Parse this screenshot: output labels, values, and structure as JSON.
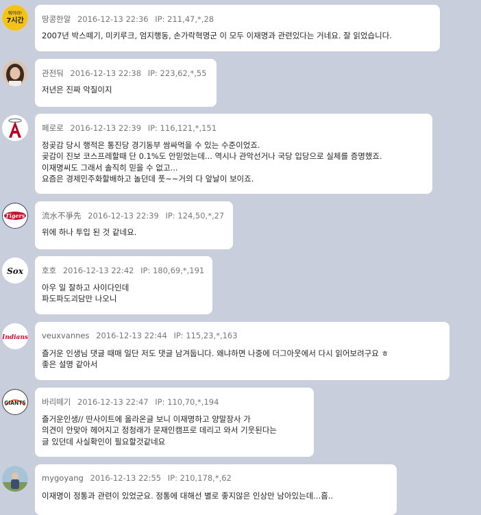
{
  "comments": [
    {
      "id": "c1",
      "nick": "땅콩한알",
      "datetime": "2016-12-13 22:36",
      "ip": "IP: 211,47,*,28",
      "lines": [
        "2007년 박스떼기, 미키루크, 엄지행동, 손가락혁명군 이 모두 이재명과 관련있다는 거네요. 잘 읽었습니다."
      ],
      "avatar": {
        "icon": "badge-7hours-icon",
        "text_top": "뛰어라!",
        "text_main": "7시간",
        "color": "#f3c317"
      }
    },
    {
      "id": "c2",
      "nick": "관전둬",
      "datetime": "2016-12-13 22:38",
      "ip": "IP: 223,62,*,55",
      "lines": [
        "저년은 진짜 악질이지"
      ],
      "avatar": {
        "icon": "woman-photo-icon"
      }
    },
    {
      "id": "c3",
      "nick": "페로로",
      "datetime": "2016-12-13 22:39",
      "ip": "IP: 116,121,*,151",
      "lines": [
        "정곶감 당시 행적은 통진당 경기동부 쌈싸먹을 수 있는 수준이었죠.",
        "곶감이 진보 코스프레할때 단 0.1%도 안믿었는데... 역시나 관악선거나 국당 입당으로 실체를 증명했죠.",
        "이재명씨도 그래서 솔직히 믿을 수 없고...",
        "요즘은 경제민주화할배하고 놀던데 풋~~거의 다 앞날이 보이죠."
      ],
      "avatar": {
        "icon": "angels-logo-icon",
        "color": "#ba0021"
      }
    },
    {
      "id": "c4",
      "nick": "流水不爭先",
      "datetime": "2016-12-13 22:39",
      "ip": "IP: 124,50,*,27",
      "lines": [
        "위에 하나 투입 된 것 같네요."
      ],
      "avatar": {
        "icon": "tigers-logo-icon",
        "text": "Tigers",
        "color": "#c8102e"
      }
    },
    {
      "id": "c5",
      "nick": "호호",
      "datetime": "2016-12-13 22:42",
      "ip": "IP: 180,69,*,191",
      "lines": [
        "아우 일 잘하고 사이다인데",
        "파도파도괴담만 나오니"
      ],
      "avatar": {
        "icon": "white-sox-logo-icon",
        "text": "Sox"
      }
    },
    {
      "id": "c6",
      "nick": "veuxvannes",
      "datetime": "2016-12-13 22:44",
      "ip": "IP: 115,23,*,163",
      "lines": [
        "즐거운 인생님 댓글 때매 일단 저도 댓글 남겨둡니다. 왜냐하면 나중에 더그아웃에서 다시 읽어보려구요 ㅎ",
        "좋은 설명 같아서"
      ],
      "avatar": {
        "icon": "indians-logo-icon",
        "text": "Indians",
        "color": "#c8102e"
      }
    },
    {
      "id": "c7",
      "nick": "바리떼기",
      "datetime": "2016-12-13 22:47",
      "ip": "IP: 110,70,*,194",
      "lines": [
        "즐거운인생// 딴사이트에 올라온글 보니 이재명하고 양말장사 가",
        "의견이 안맞아 헤어지고 정청래가 문재인캠프로 데리고 와서 기웃된다는",
        "글 있던데 사실확인이 필요할것같네요"
      ],
      "avatar": {
        "icon": "giants-logo-icon",
        "text": "GIANTS",
        "color": "#fd5a1e"
      }
    },
    {
      "id": "c8",
      "nick": "mygoyang",
      "datetime": "2016-12-13 22:55",
      "ip": "IP: 210,178,*,62",
      "lines": [
        "이재명이 정통과 관련이 있었군요. 정통에 대해선 별로 좋지않은 인상만 남아있는데...흠.."
      ],
      "avatar": {
        "icon": "person-photo-icon"
      }
    }
  ]
}
